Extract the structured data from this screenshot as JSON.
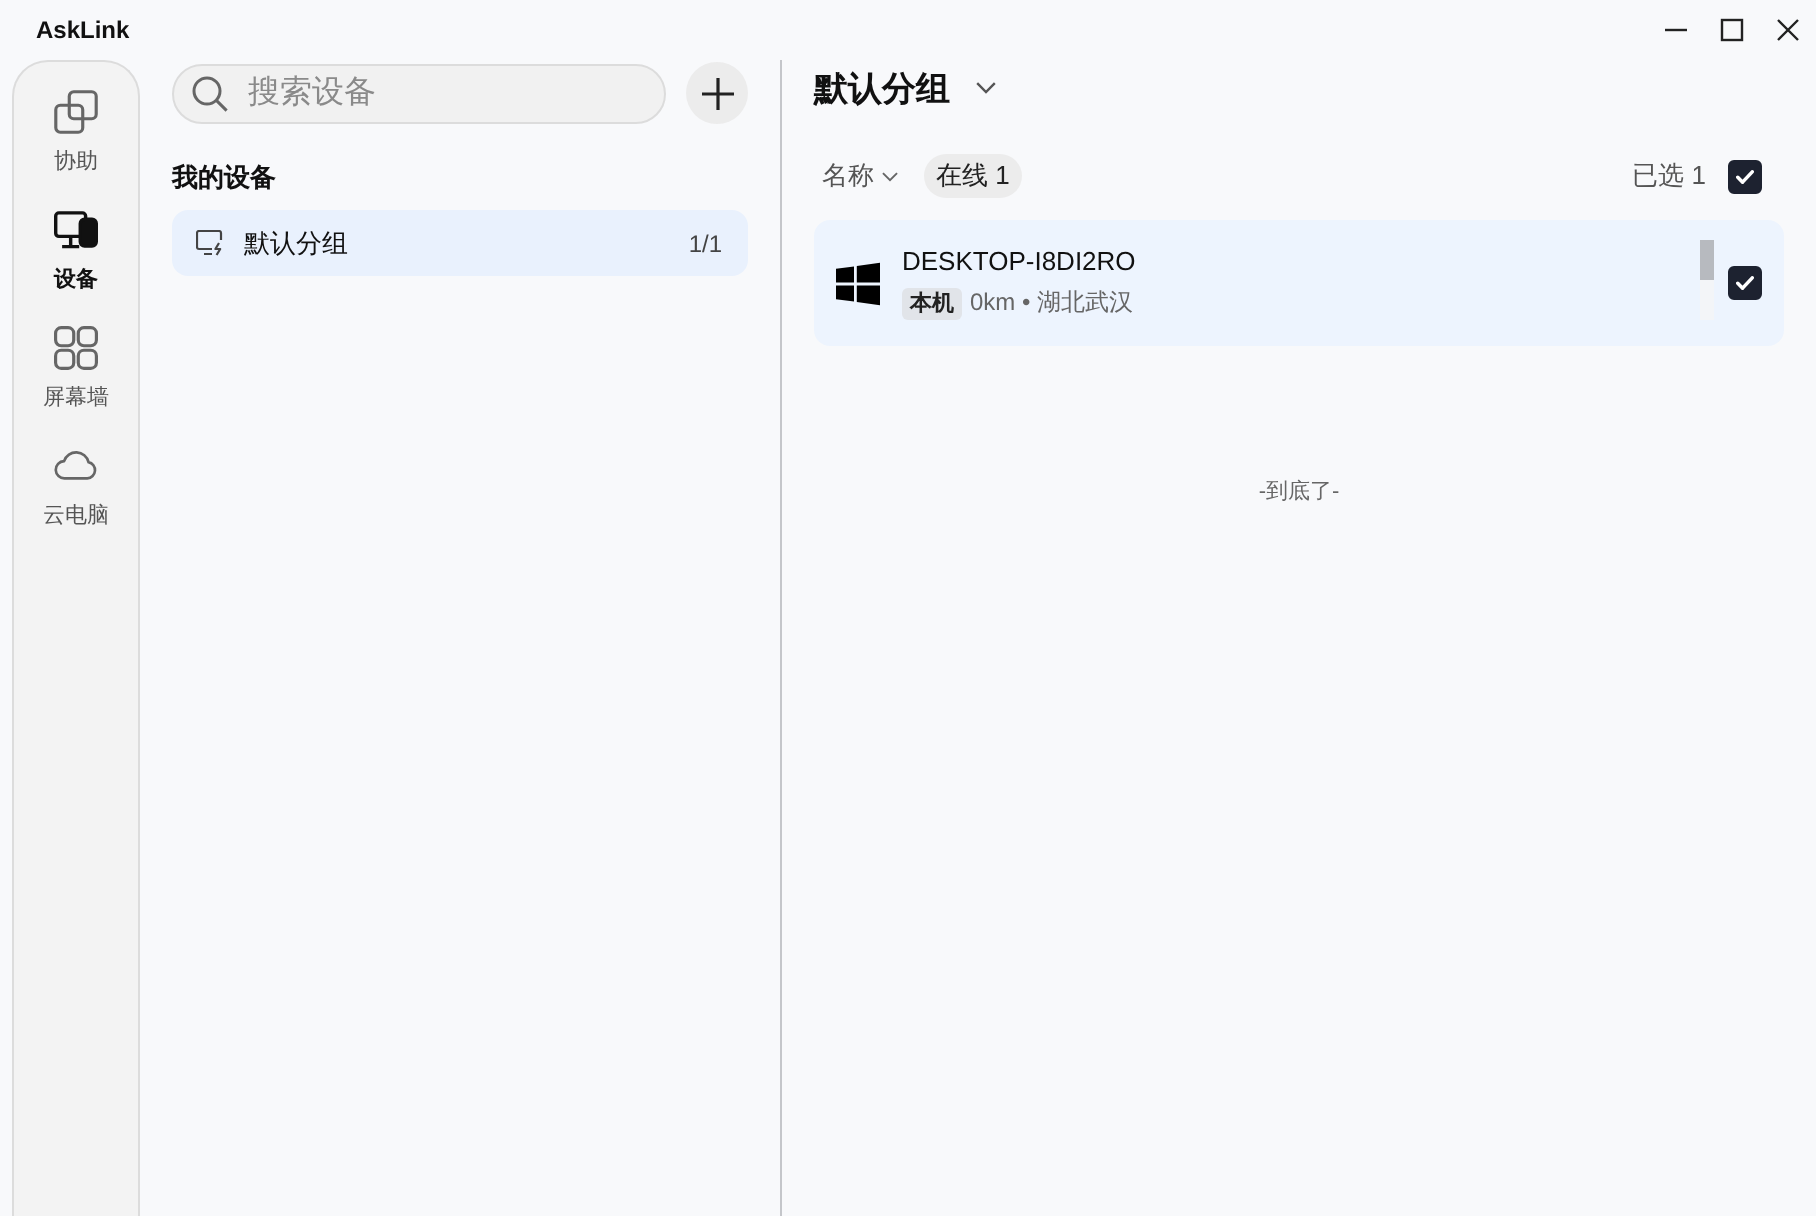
{
  "window": {
    "title": "AskLink"
  },
  "nav": [
    {
      "kind": "assist",
      "label": "协助",
      "selected": false
    },
    {
      "kind": "devices",
      "label": "设备",
      "selected": true
    },
    {
      "kind": "wall",
      "label": "屏幕墙",
      "selected": false
    },
    {
      "kind": "cloud",
      "label": "云电脑",
      "selected": false
    }
  ],
  "search": {
    "placeholder": "搜索设备"
  },
  "groups_panel": {
    "heading": "我的设备",
    "groups": [
      {
        "label": "默认分组",
        "count": "1/1",
        "selected": true
      }
    ]
  },
  "content": {
    "title": "默认分组",
    "sort": {
      "label": "名称"
    },
    "filter_chip": {
      "label": "在线 1"
    },
    "selection": {
      "label": "已选 1",
      "checked": true
    },
    "devices": [
      {
        "name": "DESKTOP-I8DI2RO",
        "tag": "本机",
        "meta": "0km • 湖北武汉",
        "checked": true
      }
    ],
    "end_note": "-到底了-"
  }
}
